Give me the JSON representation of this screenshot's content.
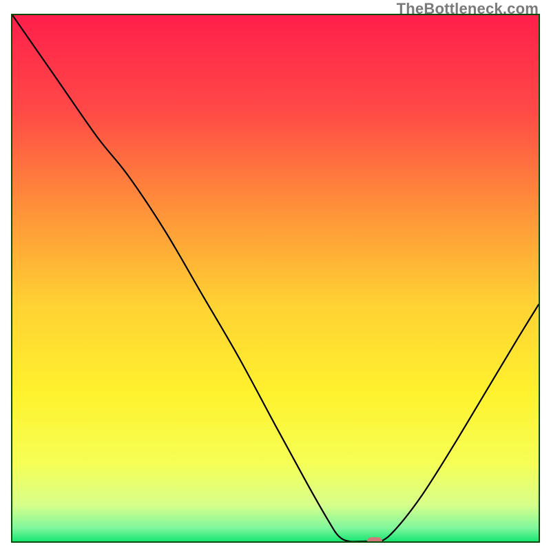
{
  "watermark": "TheBottleneck.com",
  "chart_data": {
    "type": "line",
    "title": "",
    "xlabel": "",
    "ylabel": "",
    "xlim": [
      0,
      100
    ],
    "ylim": [
      0,
      100
    ],
    "grid": false,
    "legend": false,
    "background_gradient": {
      "stops": [
        {
          "pos": 0.0,
          "color": "#ff1f4b"
        },
        {
          "pos": 0.18,
          "color": "#ff4947"
        },
        {
          "pos": 0.36,
          "color": "#ff8e3a"
        },
        {
          "pos": 0.55,
          "color": "#ffd233"
        },
        {
          "pos": 0.72,
          "color": "#fff22e"
        },
        {
          "pos": 0.85,
          "color": "#f6ff55"
        },
        {
          "pos": 0.93,
          "color": "#d8ff8a"
        },
        {
          "pos": 0.975,
          "color": "#7ef79c"
        },
        {
          "pos": 1.0,
          "color": "#17e573"
        }
      ]
    },
    "series": [
      {
        "name": "bottleneck-curve",
        "stroke": "#000000",
        "stroke_width": 2.2,
        "points": [
          {
            "x": 0.0,
            "y": 100.0
          },
          {
            "x": 8.0,
            "y": 88.5
          },
          {
            "x": 16.0,
            "y": 77.0
          },
          {
            "x": 22.0,
            "y": 69.5
          },
          {
            "x": 29.0,
            "y": 59.0
          },
          {
            "x": 36.0,
            "y": 47.0
          },
          {
            "x": 43.0,
            "y": 35.0
          },
          {
            "x": 50.0,
            "y": 22.0
          },
          {
            "x": 56.0,
            "y": 11.0
          },
          {
            "x": 60.0,
            "y": 4.0
          },
          {
            "x": 62.0,
            "y": 1.0
          },
          {
            "x": 64.0,
            "y": 0.0
          },
          {
            "x": 67.0,
            "y": 0.0
          },
          {
            "x": 70.0,
            "y": 0.0
          },
          {
            "x": 73.0,
            "y": 2.5
          },
          {
            "x": 78.0,
            "y": 9.0
          },
          {
            "x": 84.0,
            "y": 18.5
          },
          {
            "x": 90.0,
            "y": 28.5
          },
          {
            "x": 96.0,
            "y": 38.5
          },
          {
            "x": 100.0,
            "y": 45.0
          }
        ]
      }
    ],
    "marker": {
      "name": "optimal-point",
      "x": 68.5,
      "y": 0.0,
      "color": "#cf7a78",
      "shape": "rounded-rect"
    }
  }
}
